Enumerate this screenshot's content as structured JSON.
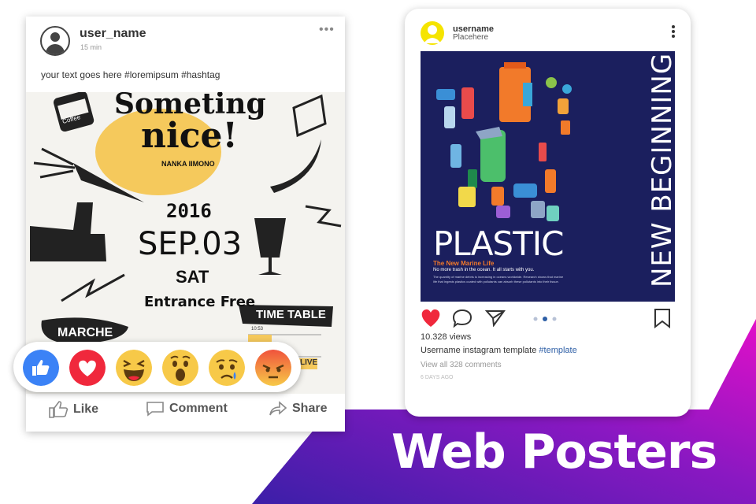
{
  "headline": "Web Posters",
  "colors": {
    "accent_blue": "#3b1fa8",
    "accent_magenta": "#e10fc8",
    "navy": "#1b1f5e",
    "like_blue": "#3b82f6",
    "heart_red": "#f0283c",
    "ig_blue": "#2e5fa6"
  },
  "facebook": {
    "username": "user_name",
    "time": "15 min",
    "post_text": "your text goes here #loremipsum #hashtag",
    "poster": {
      "line1": "Someting",
      "line2": "nice!",
      "sub": "NANKA IIMONO",
      "year": "2016",
      "date": "SEP.03",
      "day": "SAT",
      "entrance": "Entrance Free",
      "marche": "MARCHE",
      "timetable": "TIME TABLE",
      "timetable_row": "10:53",
      "live": "LIVE",
      "coffee": "Coffee"
    },
    "reactions": [
      "like-reaction",
      "love-reaction",
      "haha-reaction",
      "wow-reaction",
      "sad-reaction",
      "angry-reaction"
    ],
    "actions": {
      "like": "Like",
      "comment": "Comment",
      "share": "Share"
    }
  },
  "instagram": {
    "username": "username",
    "location": "Placehere",
    "poster": {
      "title": "PLASTIC",
      "subtitle": "The New Marine Life",
      "tagline": "No more trash in the ocean. It all starts with you.",
      "body": "The quantity of marine debris is increasing in oceans worldwide. Research shows that marine life that ingests plastics coated with pollutants can absorb these pollutants into their tissue.",
      "vertical": "NEW BEGINNING"
    },
    "views": "10.328 views",
    "caption_user": "Username",
    "caption_text": " instagram template ",
    "caption_tag": "#template",
    "comments": "View all 328 comments",
    "age": "6 DAYS AGO"
  }
}
